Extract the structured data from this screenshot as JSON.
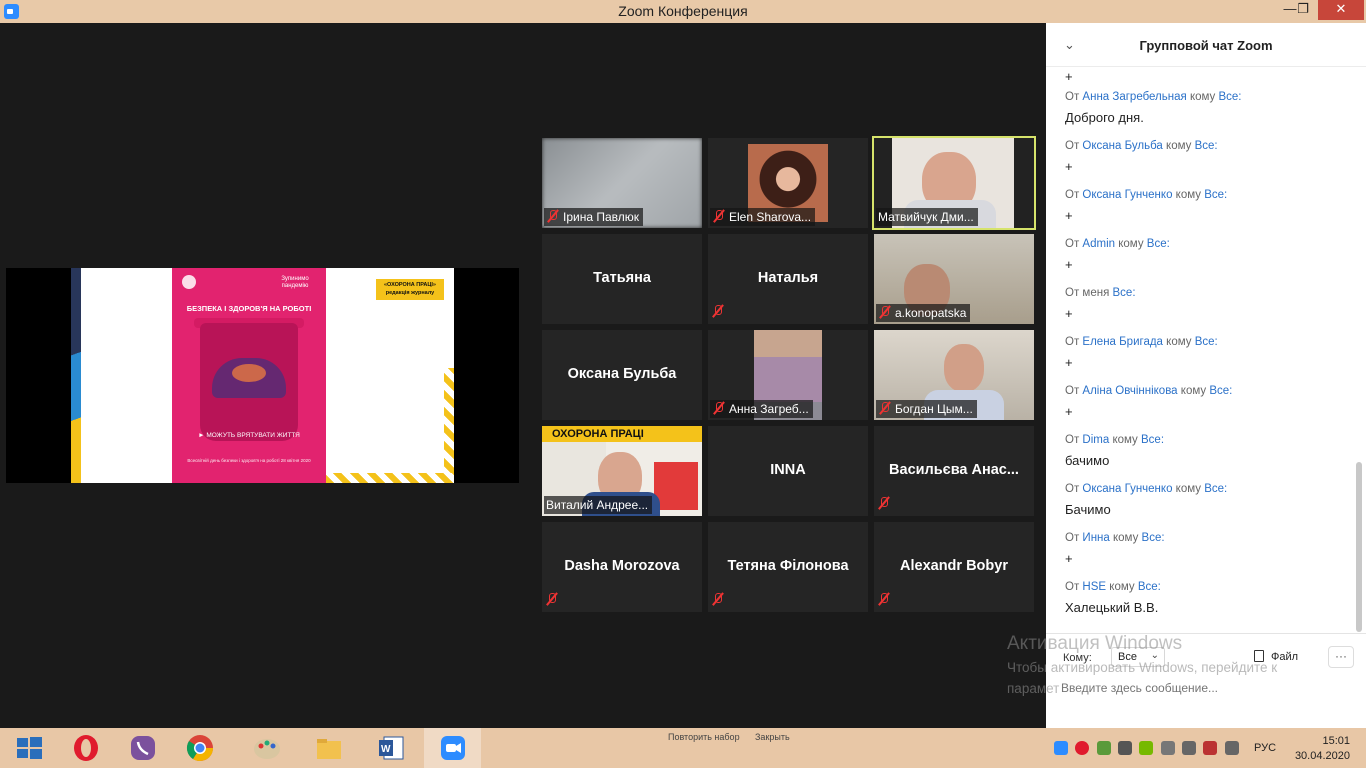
{
  "window": {
    "title": "Zoom Конференция"
  },
  "slide": {
    "head": "Зупинимо пандемію",
    "title": "БЕЗПЕКА І ЗДОРОВ'Я НА РОБОТІ",
    "cta": "► МОЖУТЬ ВРЯТУВАТИ ЖИТТЯ",
    "foot": "Всесвітній день безпеки і здоров'я на роботі 28 квітня 2020",
    "badge": "«ОХОРОНА ПРАЦІ» редакція журналу"
  },
  "participants": [
    {
      "name": "Ірина Павлюк",
      "label": "Ірина Павлюк",
      "video": true,
      "muted": true
    },
    {
      "name": "Elen Sharova...",
      "label": "Elen Sharova...",
      "video": true,
      "muted": true
    },
    {
      "name": "Матвийчук Дми...",
      "label": "Матвийчук Дми...",
      "video": true,
      "muted": false,
      "active": true
    },
    {
      "name": "Татьяна",
      "video": false,
      "muted": false
    },
    {
      "name": "Наталья",
      "video": false,
      "muted": true
    },
    {
      "name": "a.konopatska",
      "label": "a.konopatska",
      "video": true,
      "muted": true
    },
    {
      "name": "Оксана Бульба",
      "video": false,
      "muted": false
    },
    {
      "name": "Анна Загреб...",
      "label": "Анна Загреб...",
      "video": true,
      "muted": true
    },
    {
      "name": "Богдан Цым...",
      "label": "Богдан Цым...",
      "video": true,
      "muted": true
    },
    {
      "name": "Виталий Андрее...",
      "label": "Виталий Андрее...",
      "video": true,
      "muted": false
    },
    {
      "name": "INNA",
      "video": false,
      "muted": false
    },
    {
      "name": "Васильєва Анас...",
      "video": false,
      "muted": true
    },
    {
      "name": "Dasha Morozova",
      "video": false,
      "muted": true
    },
    {
      "name": "Тетяна Філонова",
      "video": false,
      "muted": true
    },
    {
      "name": "Alexandr Bobyr",
      "video": false,
      "muted": true
    }
  ],
  "newspaper": {
    "masthead": "ОХОРОНА ПРАЦІ"
  },
  "chat": {
    "title": "Групповой чат Zoom",
    "first_line": "+",
    "from_word": "От",
    "to_word": "кому",
    "messages": [
      {
        "from": "Анна Загребельная",
        "to": "Все:",
        "text": "Доброго дня."
      },
      {
        "from": "Оксана Бульба",
        "to": "Все:",
        "text": "+"
      },
      {
        "from": "Оксана Гунченко",
        "to": "Все:",
        "text": "+"
      },
      {
        "from": "Admin",
        "to": "Все:",
        "text": "+"
      },
      {
        "from": "меня",
        "to": "Все:",
        "text": "+",
        "self": true
      },
      {
        "from": "Елена Бригада",
        "to": "Все:",
        "text": "+"
      },
      {
        "from": "Аліна Овчіннікова",
        "to": "Все:",
        "text": "+"
      },
      {
        "from": "Dima",
        "to": "Все:",
        "text": "бачимо"
      },
      {
        "from": "Оксана Гунченко",
        "to": "Все:",
        "text": "Бачимо"
      },
      {
        "from": "Инна",
        "to": "Все:",
        "text": "+"
      },
      {
        "from": "HSE",
        "to": "Все:",
        "text": "Халецький В.В."
      }
    ],
    "to_label": "Кому:",
    "to_value": "Все",
    "file_label": "Файл",
    "more_label": "···",
    "input_placeholder": "Введите здесь сообщение..."
  },
  "watermark": {
    "title": "Активация Windows",
    "line1": "Чтобы активировать Windows, перейдите к",
    "line2": "парамет"
  },
  "taskbar": {
    "hint_left": "Повторить набор",
    "hint_right": "Закрыть",
    "lang": "РУС",
    "time": "15:01",
    "date": "30.04.2020"
  }
}
